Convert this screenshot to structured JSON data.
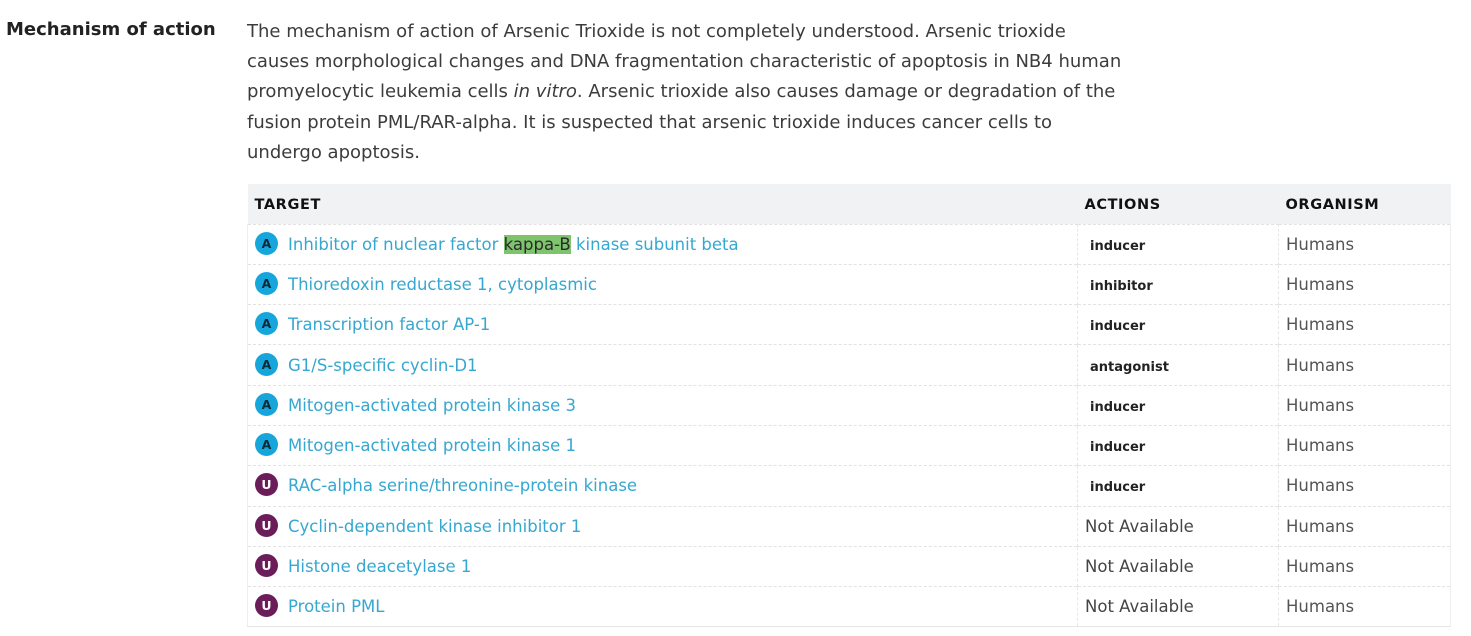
{
  "section": {
    "label": "Mechanism of action"
  },
  "description": {
    "line1": "The mechanism of action of Arsenic Trioxide is not completely understood. Arsenic trioxide",
    "line2": "causes morphological changes and DNA fragmentation characteristic of apoptosis in NB4 human",
    "line3_before": "promyelocytic leukemia cells ",
    "line3_italic": "in vitro",
    "line3_after": ". Arsenic trioxide also causes damage or degradation of the",
    "line4": "fusion protein PML/RAR-alpha. It is suspected that arsenic trioxide induces cancer cells to",
    "line5": "undergo apoptosis."
  },
  "table": {
    "headers": {
      "target": "TARGET",
      "actions": "ACTIONS",
      "organism": "ORGANISM"
    },
    "rows": [
      {
        "badge": "A",
        "target_before": "Inhibitor of nuclear factor ",
        "target_highlight": "kappa-B",
        "target_after": " kinase subunit beta",
        "action": "inducer",
        "organism": "Humans"
      },
      {
        "badge": "A",
        "target": "Thioredoxin reductase 1, cytoplasmic",
        "action": "inhibitor",
        "organism": "Humans"
      },
      {
        "badge": "A",
        "target": "Transcription factor AP-1",
        "action": "inducer",
        "organism": "Humans"
      },
      {
        "badge": "A",
        "target": "G1/S-specific cyclin-D1",
        "action": "antagonist",
        "organism": "Humans"
      },
      {
        "badge": "A",
        "target": "Mitogen-activated protein kinase 3",
        "action": "inducer",
        "organism": "Humans"
      },
      {
        "badge": "A",
        "target": "Mitogen-activated protein kinase 1",
        "action": "inducer",
        "organism": "Humans"
      },
      {
        "badge": "U",
        "target": "RAC-alpha serine/threonine-protein kinase",
        "action": "inducer",
        "organism": "Humans"
      },
      {
        "badge": "U",
        "target": "Cyclin-dependent kinase inhibitor 1",
        "action": "Not Available",
        "organism": "Humans"
      },
      {
        "badge": "U",
        "target": "Histone deacetylase 1",
        "action": "Not Available",
        "organism": "Humans"
      },
      {
        "badge": "U",
        "target": "Protein PML",
        "action": "Not Available",
        "organism": "Humans"
      }
    ]
  },
  "colors": {
    "link": "#35a7d1",
    "badge_approved": "#17a6dc",
    "badge_unknown": "#6b1d5a",
    "highlight": "#7ec46d",
    "header_bg": "#f1f2f4"
  }
}
